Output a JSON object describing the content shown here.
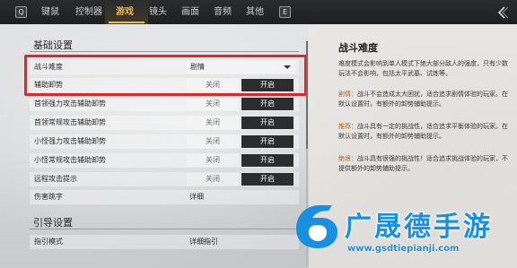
{
  "topbar": {
    "tabs": [
      {
        "label": "键鼠",
        "active": false
      },
      {
        "label": "控制器",
        "active": false
      },
      {
        "label": "游戏",
        "active": true
      },
      {
        "label": "镜头",
        "active": false
      },
      {
        "label": "画面",
        "active": false
      },
      {
        "label": "音频",
        "active": false
      },
      {
        "label": "其他",
        "active": false
      }
    ],
    "left_key": "Q",
    "right_key": "E",
    "accent_color": "#e7b75a"
  },
  "basic_settings": {
    "title": "基础设置",
    "rows": [
      {
        "label": "战斗难度",
        "type": "dropdown",
        "value": "剧情"
      },
      {
        "label": "辅助卸势",
        "type": "toggle",
        "off_label": "关闭",
        "on_label": "开启",
        "selected": "on"
      },
      {
        "label": "首领强力攻击辅助卸势",
        "type": "toggle",
        "off_label": "关闭",
        "on_label": "开启",
        "selected": "on"
      },
      {
        "label": "首领常规攻击辅助卸势",
        "type": "toggle",
        "off_label": "关闭",
        "on_label": "开启",
        "selected": "on"
      },
      {
        "label": "小怪强力攻击辅助卸势",
        "type": "toggle",
        "off_label": "关闭",
        "on_label": "开启",
        "selected": "on"
      },
      {
        "label": "小怪常规攻击辅助卸势",
        "type": "toggle",
        "off_label": "关闭",
        "on_label": "开启",
        "selected": "on"
      },
      {
        "label": "远程攻击提示",
        "type": "toggle",
        "off_label": "关闭",
        "on_label": "开启",
        "selected": "on"
      },
      {
        "label": "伤害跳字",
        "type": "value",
        "value": "详细"
      }
    ]
  },
  "guide_settings": {
    "title": "引导设置",
    "rows": [
      {
        "label": "指引模式",
        "type": "value",
        "value": "详细指引"
      }
    ]
  },
  "description": {
    "title": "战斗难度",
    "intro": "难度模式会影响到单人模式下绝大部分敌人的强度，只有少数玩法不会影响，包括太平武墓、试炼等。",
    "items": [
      {
        "keyword": "剧情：",
        "text": "战斗不会造成太大困扰，适合追求剧情体验的玩家。在默认设置时，有额外的卸势辅助提示。"
      },
      {
        "keyword": "推荐：",
        "text": "战斗具有一定的挑战性，适合追求平衡体验的玩家。在默认设置时，有额外的卸势辅助提示。"
      },
      {
        "keyword": "绝境：",
        "text": "战斗具有很强的挑战性！适合追求挑战体验的玩家，不提供额外的卸势辅助提示。"
      }
    ],
    "keyword_color": "#b5641f"
  },
  "watermark": {
    "brand": "广晟德手游",
    "url": "www.gsdtiepianji.com",
    "color": "#1a8fe0"
  },
  "highlight_color": "#e0262b"
}
